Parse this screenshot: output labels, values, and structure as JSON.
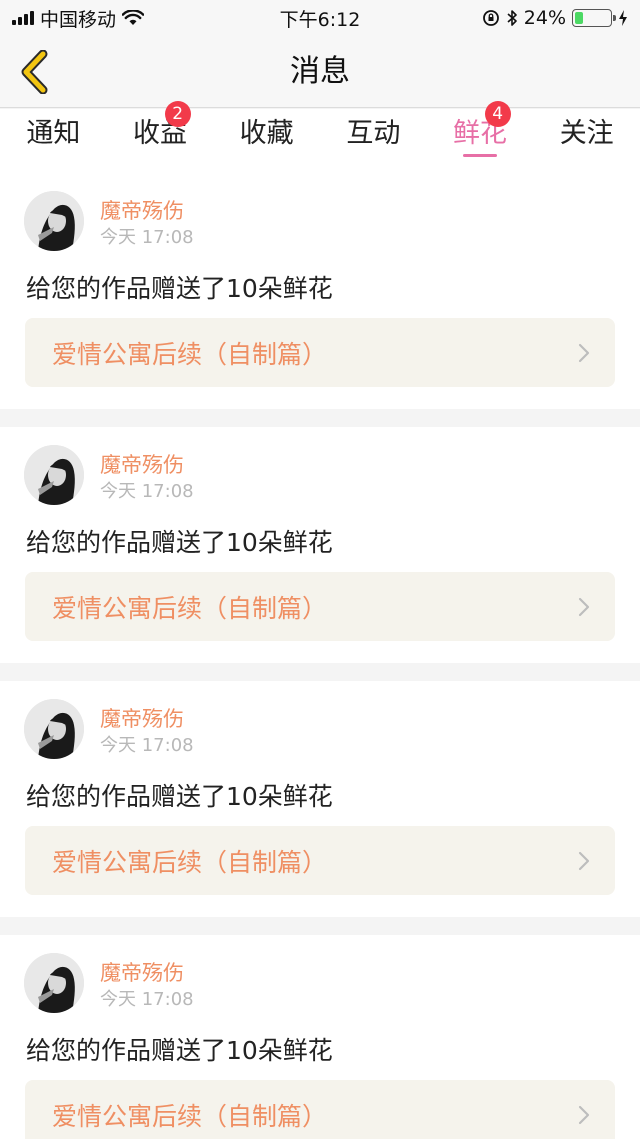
{
  "status_bar": {
    "carrier": "中国移动",
    "time": "下午6:12",
    "battery_percent": "24%",
    "battery_level": 0.24,
    "icons": [
      "signal-icon",
      "wifi-icon",
      "orientation-lock-icon",
      "bluetooth-icon",
      "battery-icon",
      "charging-icon"
    ]
  },
  "nav": {
    "title": "消息",
    "back_icon": "chevron-left-icon",
    "accent_color": "#f2c511"
  },
  "tabs": [
    {
      "label": "通知"
    },
    {
      "label": "收益",
      "badge": "2"
    },
    {
      "label": "收藏"
    },
    {
      "label": "互动"
    },
    {
      "label": "鲜花",
      "badge": "4",
      "active": true
    },
    {
      "label": "关注"
    }
  ],
  "colors": {
    "active_tab": "#e76fa6",
    "badge": "#f23a4a",
    "username": "#ef8f63",
    "link_bg": "#f5f3ec"
  },
  "messages": [
    {
      "user": "魔帝殇伤",
      "time": "今天 17:08",
      "text": "给您的作品赠送了10朵鲜花",
      "work": "爱情公寓后续（自制篇）"
    },
    {
      "user": "魔帝殇伤",
      "time": "今天 17:08",
      "text": "给您的作品赠送了10朵鲜花",
      "work": "爱情公寓后续（自制篇）"
    },
    {
      "user": "魔帝殇伤",
      "time": "今天 17:08",
      "text": "给您的作品赠送了10朵鲜花",
      "work": "爱情公寓后续（自制篇）"
    },
    {
      "user": "魔帝殇伤",
      "time": "今天 17:08",
      "text": "给您的作品赠送了10朵鲜花",
      "work": "爱情公寓后续（自制篇）"
    }
  ]
}
